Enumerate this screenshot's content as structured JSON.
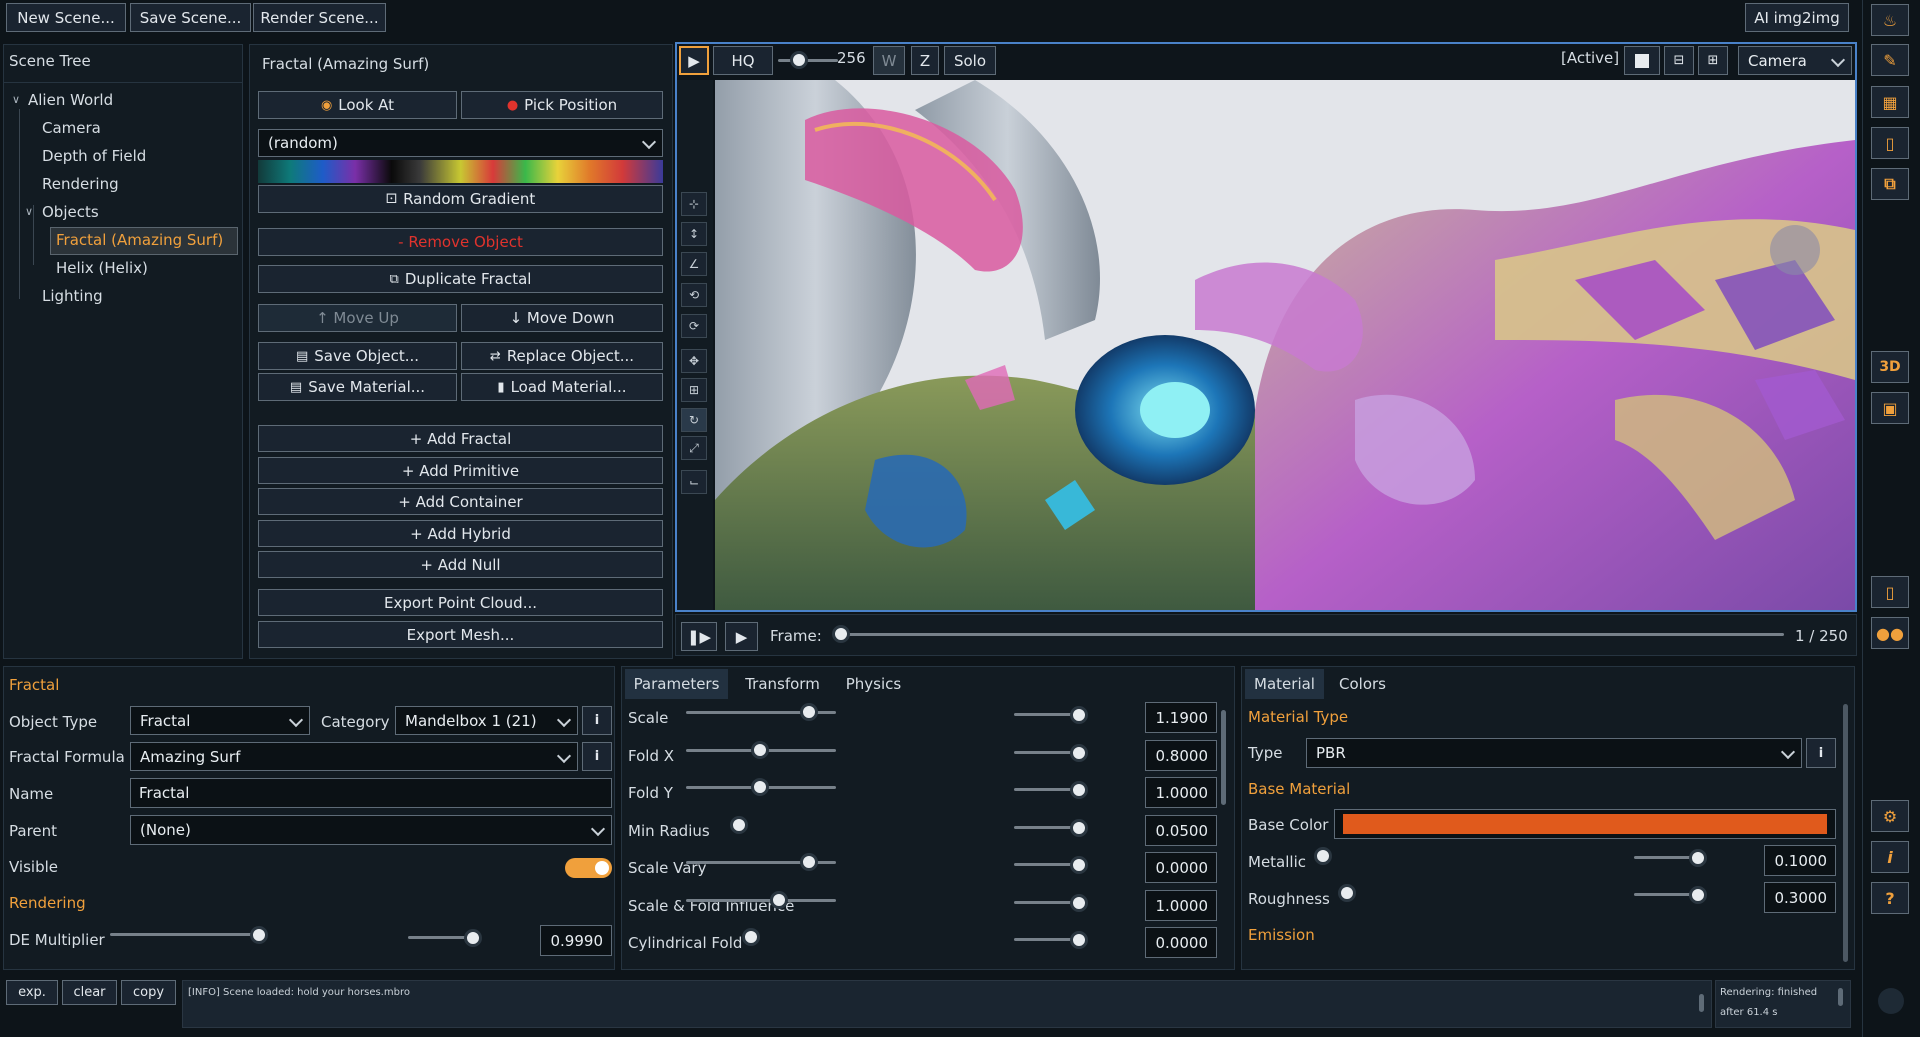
{
  "topbar": {
    "new_scene": "New Scene...",
    "save_scene": "Save Scene...",
    "render_scene": "Render Scene...",
    "ai_img2img": "AI img2img"
  },
  "scene_tree": {
    "title": "Scene Tree",
    "root": "Alien World",
    "items": [
      "Camera",
      "Depth of Field",
      "Rendering"
    ],
    "objects_label": "Objects",
    "objects": [
      "Fractal (Amazing Surf)",
      "Helix (Helix)"
    ],
    "lighting": "Lighting"
  },
  "object_panel": {
    "title": "Fractal (Amazing Surf)",
    "look_at": "Look At",
    "pick_position": "Pick Position",
    "gradient_select": "(random)",
    "random_gradient": "Random Gradient",
    "remove_object": "- Remove Object",
    "duplicate": "Duplicate Fractal",
    "move_up": "↑ Move Up",
    "move_down": "↓ Move Down",
    "save_object": "Save Object...",
    "replace_object": "Replace Object...",
    "save_material": "Save Material...",
    "load_material": "Load Material...",
    "add_buttons": [
      "+ Add Fractal",
      "+ Add Primitive",
      "+ Add Container",
      "+ Add Hybrid",
      "+ Add Null"
    ],
    "export_point_cloud": "Export Point Cloud...",
    "export_mesh": "Export Mesh..."
  },
  "viewport": {
    "hq": "HQ",
    "samples": "256",
    "samples_slider": 0.1,
    "w": "W",
    "z": "Z",
    "solo": "Solo",
    "active": "[Active]",
    "camera_select": "Camera",
    "frame_label": "Frame:",
    "frame_counter": "1 / 250",
    "frame_progress": 0.0
  },
  "fractal_props": {
    "section": "Fractal",
    "object_type_label": "Object Type",
    "object_type": "Fractal",
    "category_label": "Category",
    "category": "Mandelbox 1 (21)",
    "formula_label": "Fractal Formula",
    "formula": "Amazing Surf",
    "name_label": "Name",
    "name": "Fractal",
    "parent_label": "Parent",
    "parent": "(None)",
    "visible_label": "Visible",
    "visible": true,
    "rendering_section": "Rendering",
    "de_label": "DE Multiplier",
    "de_value": "0.9990",
    "de_slider": 0.9
  },
  "params": {
    "tabs": [
      "Parameters",
      "Transform",
      "Physics"
    ],
    "rows": [
      {
        "label": "Scale",
        "value": "1.1900",
        "pos": 0.8
      },
      {
        "label": "Fold X",
        "value": "0.8000",
        "pos": 0.47
      },
      {
        "label": "Fold Y",
        "value": "1.0000",
        "pos": 0.47
      },
      {
        "label": "Min Radius",
        "value": "0.0500",
        "pos": 0.0
      },
      {
        "label": "Scale Vary",
        "value": "0.0000",
        "pos": 0.8
      },
      {
        "label": "Scale & Fold Influence",
        "value": "1.0000",
        "pos": 0.6
      },
      {
        "label": "Cylindrical Fold",
        "value": "0.0000",
        "pos": 0.0
      }
    ]
  },
  "material": {
    "tabs": [
      "Material",
      "Colors"
    ],
    "type_section": "Material Type",
    "type_label": "Type",
    "type": "PBR",
    "base_section": "Base Material",
    "base_color_label": "Base Color",
    "base_color": "#e05a1c",
    "metallic_label": "Metallic",
    "metallic": "0.1000",
    "roughness_label": "Roughness",
    "roughness": "0.3000",
    "emission_section": "Emission"
  },
  "console": {
    "exp": "exp.",
    "clear": "clear",
    "copy": "copy",
    "log": "[INFO] Scene loaded: hold your horses.mbro",
    "status_line1": "Rendering:  finished",
    "status_line2": "after 61.4 s"
  },
  "right_toolbar": {
    "buttons": [
      "flame-icon",
      "pencil-icon",
      "grid-icon",
      "folder-icon",
      "layers-icon",
      "3d-icon",
      "image-icon",
      "phone-icon",
      "gamepad-icon",
      "settings-icon",
      "info-icon",
      "help-icon"
    ],
    "label_3d": "3D",
    "label_info": "i",
    "label_help": "?"
  },
  "colors": {
    "accent": "#f0a03c",
    "active_border": "#4a82c9",
    "remove": "#e0332d"
  }
}
